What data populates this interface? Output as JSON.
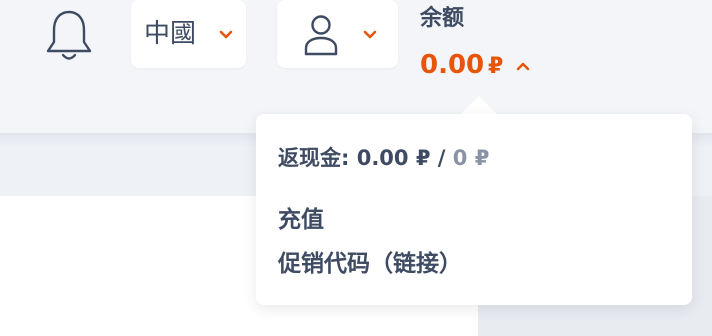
{
  "header": {
    "notifications": {
      "icon": "bell-icon"
    },
    "language": {
      "selected": "中國",
      "icon": "chevron-down-icon"
    },
    "account": {
      "icon": "user-icon",
      "chevron_icon": "chevron-down-icon"
    },
    "balance": {
      "label": "余额",
      "amount": "0.00",
      "currency": "₽",
      "expanded_icon": "chevron-up-icon"
    }
  },
  "balance_dropdown": {
    "cashback": {
      "label": "返现金:",
      "amount": "0.00",
      "currency": "₽",
      "separator": "/",
      "limit": "0",
      "limit_currency": "₽"
    },
    "links": {
      "top_up": "充值",
      "promo_code": "促销代码（链接）"
    }
  },
  "colors": {
    "accent": "#e8550a",
    "text": "#3e4b63",
    "muted": "#8a93a6",
    "header_bg": "#f3f5f8"
  }
}
